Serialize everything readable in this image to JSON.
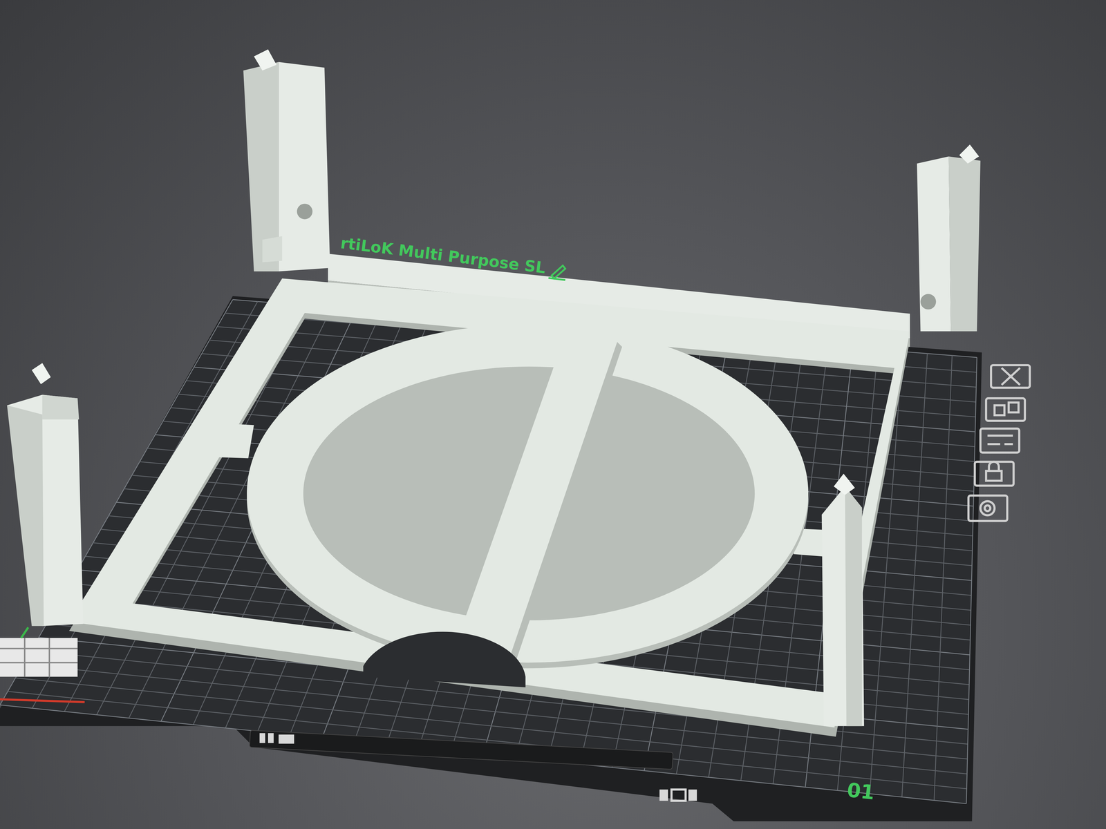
{
  "object_label": {
    "text": "rtiLoK Multi Purpose SL"
  },
  "bed_number": "01"
}
